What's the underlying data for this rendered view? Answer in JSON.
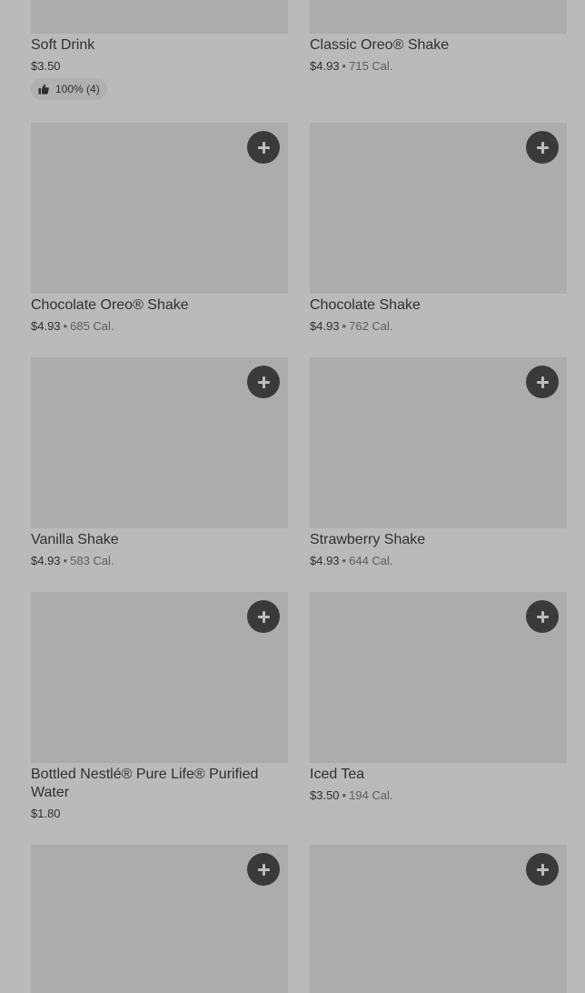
{
  "menu": {
    "add_button_label": "+",
    "items": [
      {
        "name": "Soft Drink",
        "price": "$3.50",
        "separator": "",
        "calories": "",
        "rating": "100% (4)"
      },
      {
        "name": "Classic Oreo® Shake",
        "price": "$4.93",
        "separator": "•",
        "calories": "715 Cal."
      },
      {
        "name": "Chocolate Oreo® Shake",
        "price": "$4.93",
        "separator": "•",
        "calories": "685 Cal."
      },
      {
        "name": "Chocolate Shake",
        "price": "$4.93",
        "separator": "•",
        "calories": "762 Cal."
      },
      {
        "name": "Vanilla Shake",
        "price": "$4.93",
        "separator": "•",
        "calories": "583 Cal."
      },
      {
        "name": "Strawberry Shake",
        "price": "$4.93",
        "separator": "•",
        "calories": "644 Cal."
      },
      {
        "name": "Bottled Nestlé® Pure Life® Purified Water",
        "price": "$1.80",
        "separator": "",
        "calories": ""
      },
      {
        "name": "Iced Tea",
        "price": "$3.50",
        "separator": "•",
        "calories": "194 Cal."
      }
    ]
  },
  "colors": {
    "page_background": "#bababa",
    "image_placeholder": "#acacac",
    "add_button": "#3a3a3a"
  }
}
